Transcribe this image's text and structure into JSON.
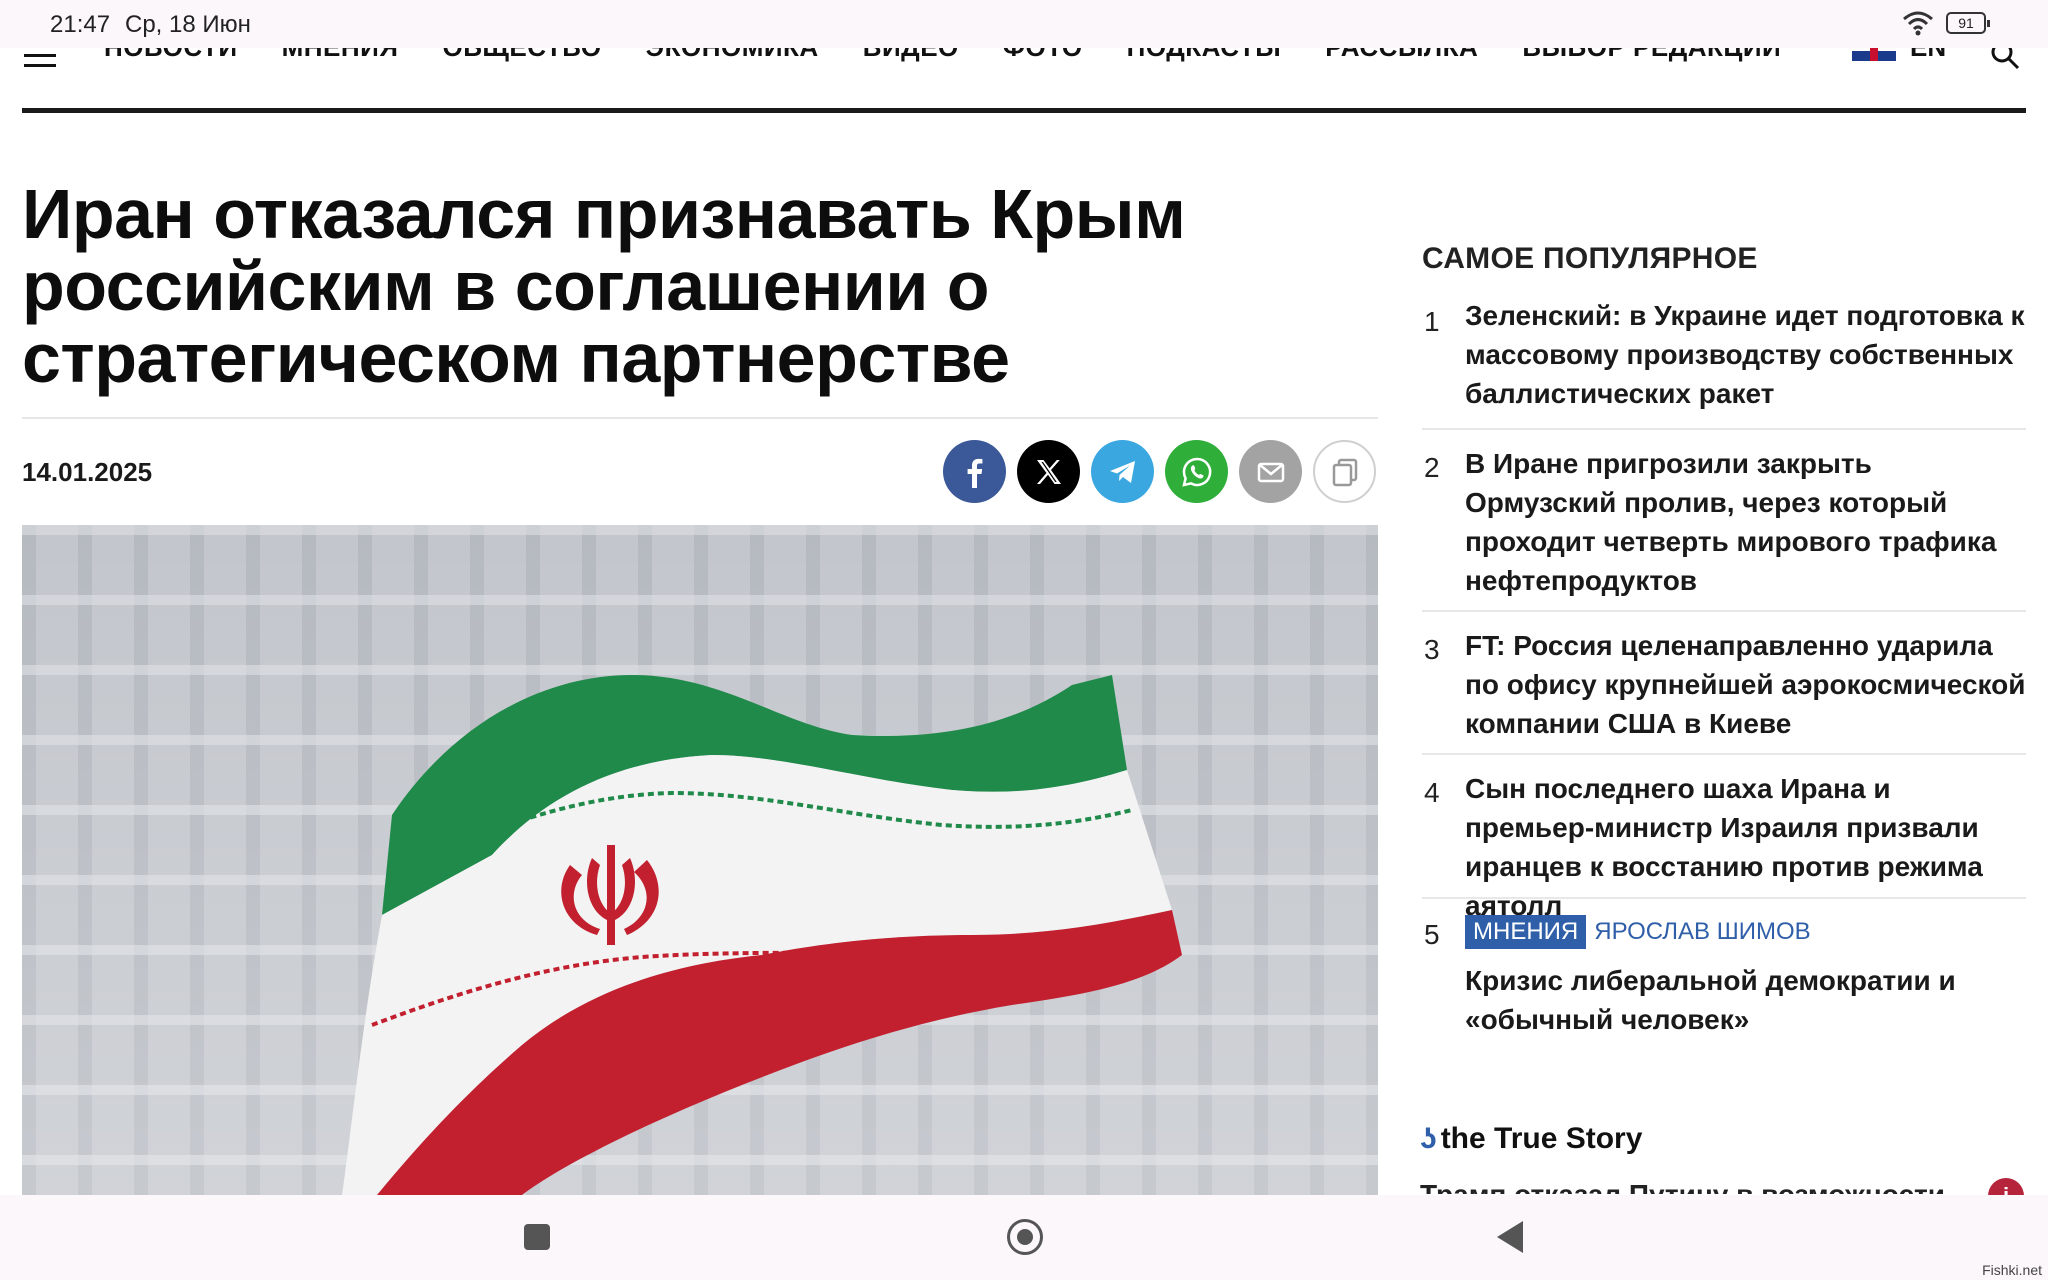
{
  "status": {
    "time": "21:47",
    "date": "Ср, 18 Июн",
    "battery": "91"
  },
  "nav": {
    "items": [
      "НОВОСТИ",
      "МНЕНИЯ",
      "ОБЩЕСТВО",
      "ЭКОНОМИКА",
      "ВИДЕО",
      "ФОТО",
      "ПОДКАСТЫ",
      "РАССЫЛКА",
      "ВЫБОР РЕДАКЦИИ"
    ],
    "lang": "EN"
  },
  "article": {
    "title": "Иран отказался признавать Крым российским в соглашении о стратегическом партнерстве",
    "date": "14.01.2025",
    "share": [
      "facebook-icon",
      "x-icon",
      "telegram-icon",
      "whatsapp-icon",
      "mail-icon",
      "copy-icon"
    ]
  },
  "sidebar": {
    "title": "САМОЕ ПОПУЛЯРНОЕ",
    "items": [
      {
        "num": "1",
        "text": "Зеленский: в Украине идет подготовка к массовому производству собственных баллистических ракет"
      },
      {
        "num": "2",
        "text": "В Иране пригрозили закрыть Ормузский пролив, через который проходит четверть мирового трафика нефтепродуктов"
      },
      {
        "num": "3",
        "text": "FT: Россия целенаправленно ударила по офису крупнейшей аэрокосмической компании США в Киеве"
      },
      {
        "num": "4",
        "text": "Сын последнего шаха Ирана и премьер-министр Израиля призвали иранцев к восстанию против режима аятолл"
      },
      {
        "num": "5",
        "tag": "МНЕНИЯ",
        "author": "ЯРОСЛАВ ШИМОВ",
        "text": "Кризис либеральной демократии и «обычный человек»"
      }
    ],
    "ad_title": "the True Story",
    "ad_sub": "Трамп отказал Путину в возможности"
  },
  "watermark": "Fishki.net",
  "colors": {
    "accent": "#2f5fa8",
    "flag_green": "#1f8a4a",
    "flag_red": "#c2202f"
  }
}
